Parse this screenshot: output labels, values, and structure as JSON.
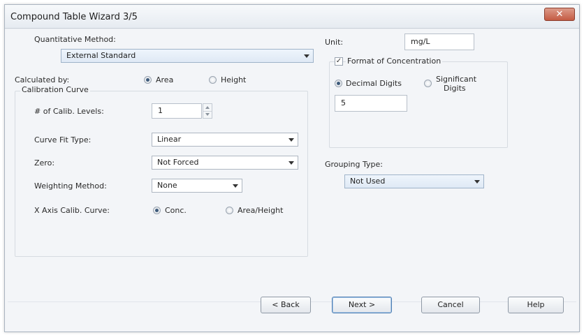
{
  "window": {
    "title": "Compound Table Wizard 3/5",
    "close_glyph": "✕"
  },
  "quantitative_method": {
    "label": "Quantitative Method:",
    "value": "External Standard"
  },
  "calculated_by": {
    "label": "Calculated by:",
    "options": [
      {
        "label": "Area",
        "checked": true
      },
      {
        "label": "Height",
        "checked": false
      }
    ]
  },
  "calibration_curve": {
    "group_label": "Calibration Curve",
    "levels_label": "# of Calib. Levels:",
    "levels_value": "1",
    "fit_type_label": "Curve Fit Type:",
    "fit_type_value": "Linear",
    "zero_label": "Zero:",
    "zero_value": "Not Forced",
    "weighting_label": "Weighting Method:",
    "weighting_value": "None",
    "x_axis_label": "X Axis Calib. Curve:",
    "x_axis_options": [
      {
        "label": "Conc.",
        "checked": true
      },
      {
        "label": "Area/Height",
        "checked": false
      }
    ]
  },
  "unit": {
    "label": "Unit:",
    "value": "mg/L"
  },
  "format_of_concentration": {
    "label": "Format of Concentration",
    "checked": true,
    "check_glyph": "✓",
    "decimal_digits_label": "Decimal Digits",
    "decimal_digits_checked": true,
    "significant_digits_label_line1": "Significant",
    "significant_digits_label_line2": "Digits",
    "significant_digits_checked": false,
    "digits_value": "5"
  },
  "grouping_type": {
    "label": "Grouping Type:",
    "value": "Not Used"
  },
  "buttons": {
    "back": "< Back",
    "next": "Next >",
    "cancel": "Cancel",
    "help": "Help"
  }
}
